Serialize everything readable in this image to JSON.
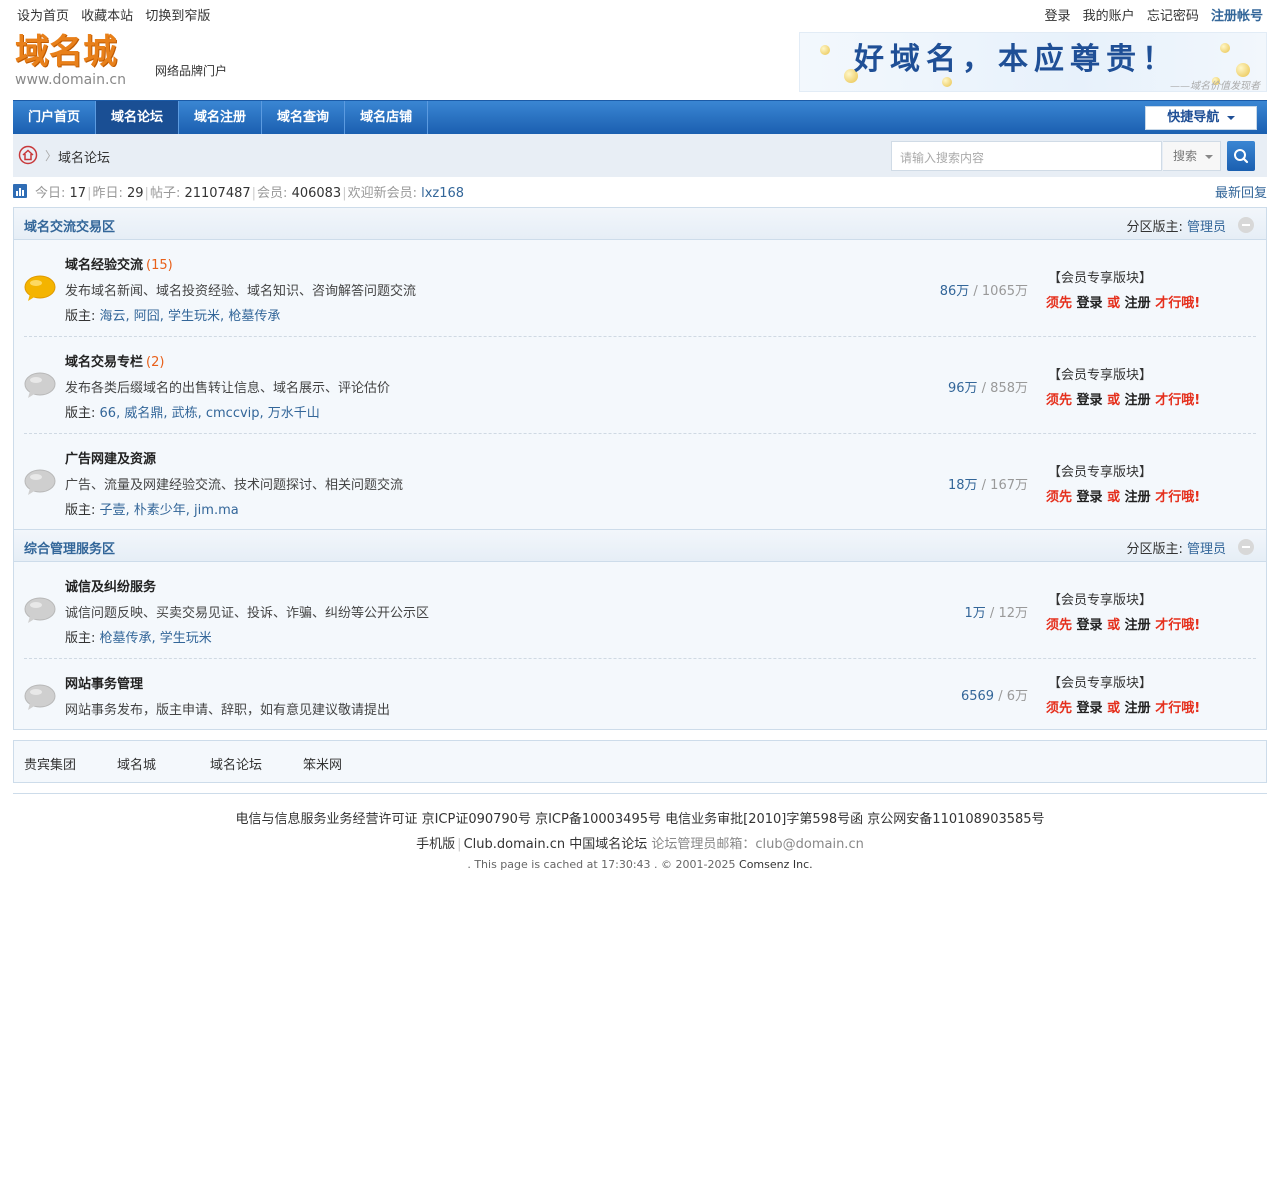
{
  "topbar": {
    "left": [
      "设为首页",
      "收藏本站",
      "切换到窄版"
    ],
    "right": [
      "登录",
      "我的账户",
      "忘记密码"
    ],
    "register": "注册帐号"
  },
  "header": {
    "logo_main": "域名城",
    "logo_sub": "www.domain.cn",
    "slogan": "网络品牌门户",
    "banner_text": "好域名，本应尊贵！",
    "banner_sub": "——域名价值发现者"
  },
  "nav": {
    "items": [
      "门户首页",
      "域名论坛",
      "域名注册",
      "域名查询",
      "域名店铺"
    ],
    "active_index": 1,
    "quick": "快捷导航"
  },
  "breadcrumb": {
    "current": "域名论坛"
  },
  "search": {
    "placeholder": "请输入搜索内容",
    "type_label": "搜索"
  },
  "stats": {
    "today_label": "今日:",
    "today": "17",
    "yesterday_label": "昨日:",
    "yesterday": "29",
    "posts_label": "帖子:",
    "posts": "21107487",
    "members_label": "会员:",
    "members": "406083",
    "newest_label": "欢迎新会员:",
    "newest": "lxz168",
    "latest_reply": "最新回复"
  },
  "sections": [
    {
      "title": "域名交流交易区",
      "mod_label": "分区版主:",
      "mod": "管理员",
      "forums": [
        {
          "name": "域名经验交流",
          "count": "(15)",
          "active": true,
          "desc": "发布域名新闻、域名投资经验、域名知识、咨询解答问题交流",
          "mods_label": "版主:",
          "mods": "海云, 阿囧, 学生玩米, 枪墓传承",
          "threads": "86万",
          "posts": "1065万"
        },
        {
          "name": "域名交易专栏",
          "count": "(2)",
          "active": false,
          "desc": "发布各类后缀域名的出售转让信息、域名展示、评论估价",
          "mods_label": "版主:",
          "mods": "66, 威名鼎, 武栋, cmccvip, 万水千山",
          "threads": "96万",
          "posts": "858万"
        },
        {
          "name": "广告网建及资源",
          "count": "",
          "active": false,
          "desc": "广告、流量及网建经验交流、技术问题探讨、相关问题交流",
          "mods_label": "版主:",
          "mods": "子壹, 朴素少年, jim.ma",
          "threads": "18万",
          "posts": "167万"
        }
      ]
    },
    {
      "title": "综合管理服务区",
      "mod_label": "分区版主:",
      "mod": "管理员",
      "forums": [
        {
          "name": "诚信及纠纷服务",
          "count": "",
          "active": false,
          "desc": "诚信问题反映、买卖交易见证、投诉、诈骗、纠纷等公开公示区",
          "mods_label": "版主:",
          "mods": "枪墓传承, 学生玩米",
          "threads": "1万",
          "posts": "12万"
        },
        {
          "name": "网站事务管理",
          "count": "",
          "active": false,
          "desc": "网站事务发布，版主申请、辞职，如有意见建议敬请提出",
          "mods_label": "",
          "mods": "",
          "threads": "6569",
          "posts": "6万"
        }
      ]
    }
  ],
  "member_block": {
    "label": "【会员专享版块】",
    "must": "须先",
    "login": "登录",
    "or": "或",
    "register": "注册",
    "end": "才行哦!"
  },
  "friend_links": [
    "贵宾集团",
    "域名城",
    "域名论坛",
    "笨米网"
  ],
  "footer": {
    "line1": "电信与信息服务业务经营许可证 京ICP证090790号  京ICP备10003495号  电信业务审批[2010]字第598号函  京公网安备110108903585号",
    "mobile": "手机版",
    "site": "Club.domain.cn 中国域名论坛",
    "email_label": "论坛管理员邮箱：",
    "email": "club@domain.cn",
    "cache": ". This page is cached at 17:30:43 . © 2001-2025",
    "company": "Comsenz Inc."
  },
  "colors": {
    "link": "#336699",
    "nav_blue": "#1b5fb0",
    "logo_orange": "#e8801a",
    "accent_red": "#e52f1c"
  }
}
